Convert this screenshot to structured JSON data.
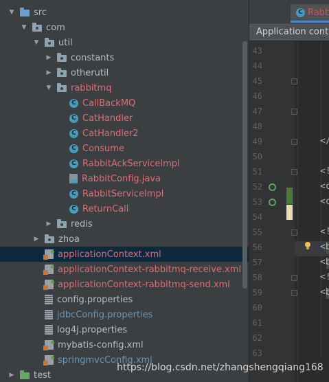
{
  "project_tree": {
    "items": [
      {
        "label": "src",
        "indent": 0,
        "arrow": "down",
        "icon": "src-folder-icon",
        "color": "normal"
      },
      {
        "label": "com",
        "indent": 1,
        "arrow": "down",
        "icon": "package-folder-icon",
        "color": "normal"
      },
      {
        "label": "util",
        "indent": 2,
        "arrow": "down",
        "icon": "package-folder-icon",
        "color": "normal"
      },
      {
        "label": "constants",
        "indent": 3,
        "arrow": "right",
        "icon": "package-folder-icon",
        "color": "normal"
      },
      {
        "label": "otherutil",
        "indent": 3,
        "arrow": "right",
        "icon": "package-folder-icon",
        "color": "normal"
      },
      {
        "label": "rabbitmq",
        "indent": 3,
        "arrow": "down",
        "icon": "package-folder-icon",
        "color": "red"
      },
      {
        "label": "CallBackMQ",
        "indent": 4,
        "arrow": "none",
        "icon": "class-icon",
        "color": "red"
      },
      {
        "label": "CatHandler",
        "indent": 4,
        "arrow": "none",
        "icon": "class-icon",
        "color": "red"
      },
      {
        "label": "CatHandler2",
        "indent": 4,
        "arrow": "none",
        "icon": "class-icon",
        "color": "red"
      },
      {
        "label": "Consume",
        "indent": 4,
        "arrow": "none",
        "icon": "class-icon",
        "color": "red"
      },
      {
        "label": "RabbitAckServiceImpl",
        "indent": 4,
        "arrow": "none",
        "icon": "class-icon",
        "color": "red"
      },
      {
        "label": "RabbitConfig.java",
        "indent": 4,
        "arrow": "none",
        "icon": "java-file-icon",
        "color": "red"
      },
      {
        "label": "RabbitServiceImpl",
        "indent": 4,
        "arrow": "none",
        "icon": "class-icon",
        "color": "red"
      },
      {
        "label": "ReturnCall",
        "indent": 4,
        "arrow": "none",
        "icon": "class-icon",
        "color": "red"
      },
      {
        "label": "redis",
        "indent": 3,
        "arrow": "right",
        "icon": "package-folder-icon",
        "color": "normal"
      },
      {
        "label": "zhoa",
        "indent": 2,
        "arrow": "right",
        "icon": "package-folder-icon",
        "color": "normal"
      },
      {
        "label": "applicationContext.xml",
        "indent": 2,
        "arrow": "none",
        "icon": "xml-file-icon",
        "color": "selected-red"
      },
      {
        "label": "applicationContext-rabbitmq-receive.xml",
        "indent": 2,
        "arrow": "none",
        "icon": "xml-file-icon",
        "color": "red"
      },
      {
        "label": "applicationContext-rabbitmq-send.xml",
        "indent": 2,
        "arrow": "none",
        "icon": "xml-file-icon",
        "color": "red"
      },
      {
        "label": "config.properties",
        "indent": 2,
        "arrow": "none",
        "icon": "properties-file-icon",
        "color": "normal"
      },
      {
        "label": "jdbcConfig.properties",
        "indent": 2,
        "arrow": "none",
        "icon": "properties-file-icon",
        "color": "blue"
      },
      {
        "label": "log4j.properties",
        "indent": 2,
        "arrow": "none",
        "icon": "properties-file-icon",
        "color": "normal"
      },
      {
        "label": "mybatis-config.xml",
        "indent": 2,
        "arrow": "none",
        "icon": "xml-file-icon",
        "color": "normal"
      },
      {
        "label": "springmvcConfig.xml",
        "indent": 2,
        "arrow": "none",
        "icon": "xml-file-icon",
        "color": "blue"
      },
      {
        "label": "test",
        "indent": 0,
        "arrow": "right",
        "icon": "test-folder-icon",
        "color": "normal"
      }
    ],
    "selected_index": 16
  },
  "editor": {
    "tab_label": "Rabbi",
    "breadcrumb": "Application conte",
    "line_numbers": [
      "43",
      "44",
      "45",
      "46",
      "47",
      "48",
      "49",
      "50",
      "51",
      "52",
      "53",
      "54",
      "55",
      "56",
      "57",
      "58",
      "59",
      "60",
      "61",
      "62",
      "63"
    ],
    "code_lines": [
      {
        "line": 49,
        "text": "</"
      },
      {
        "line": 51,
        "text": "<!"
      },
      {
        "line": 52,
        "text": "<c"
      },
      {
        "line": 53,
        "text": "<c"
      },
      {
        "line": 55,
        "text": "<!"
      },
      {
        "line": 56,
        "text": "<b"
      },
      {
        "line": 57,
        "text": "<b"
      },
      {
        "line": 58,
        "text": "<!"
      },
      {
        "line": 59,
        "text": "<b"
      }
    ]
  },
  "watermark": "https://blog.csdn.net/zhangshengqiang168",
  "colors": {
    "panel_bg": "#3c3f41",
    "editor_bg": "#2b2b2b",
    "selection": "#0d293e",
    "unversioned_red": "#e06c75",
    "modified_blue": "#6897bb"
  }
}
